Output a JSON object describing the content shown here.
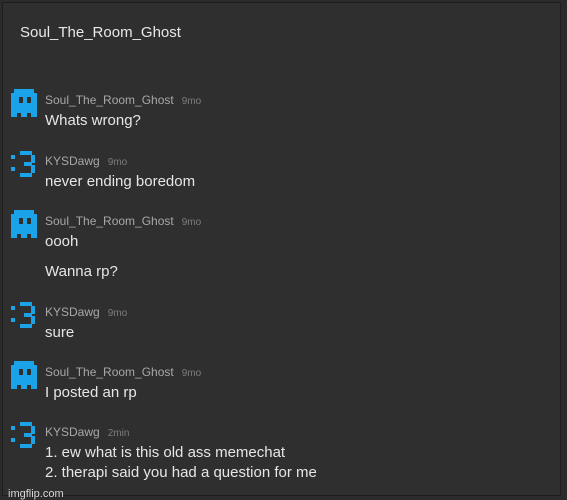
{
  "chat": {
    "title": "Soul_The_Room_Ghost"
  },
  "avatar_colors": {
    "primary": "#1aa3e8",
    "dark": "#1f1f1f"
  },
  "messages": [
    {
      "user": "Soul_The_Room_Ghost",
      "time": "9mo",
      "avatar_icon": "ghost-icon",
      "lines": [
        "Whats wrong?"
      ]
    },
    {
      "user": "KYSDawg",
      "time": "9mo",
      "avatar_icon": "smiley-icon",
      "lines": [
        "never ending boredom"
      ]
    },
    {
      "user": "Soul_The_Room_Ghost",
      "time": "9mo",
      "avatar_icon": "ghost-icon",
      "lines": [
        "oooh",
        "Wanna rp?"
      ]
    },
    {
      "user": "KYSDawg",
      "time": "9mo",
      "avatar_icon": "smiley-icon",
      "lines": [
        "sure"
      ]
    },
    {
      "user": "Soul_The_Room_Ghost",
      "time": "9mo",
      "avatar_icon": "ghost-icon",
      "lines": [
        "I posted an rp"
      ]
    },
    {
      "user": "KYSDawg",
      "time": "2min",
      "avatar_icon": "smiley-icon",
      "lines": [
        "1. ew what is this old ass memechat",
        "2. therapi said you had a question for me"
      ]
    }
  ],
  "watermark": "imgflip.com"
}
